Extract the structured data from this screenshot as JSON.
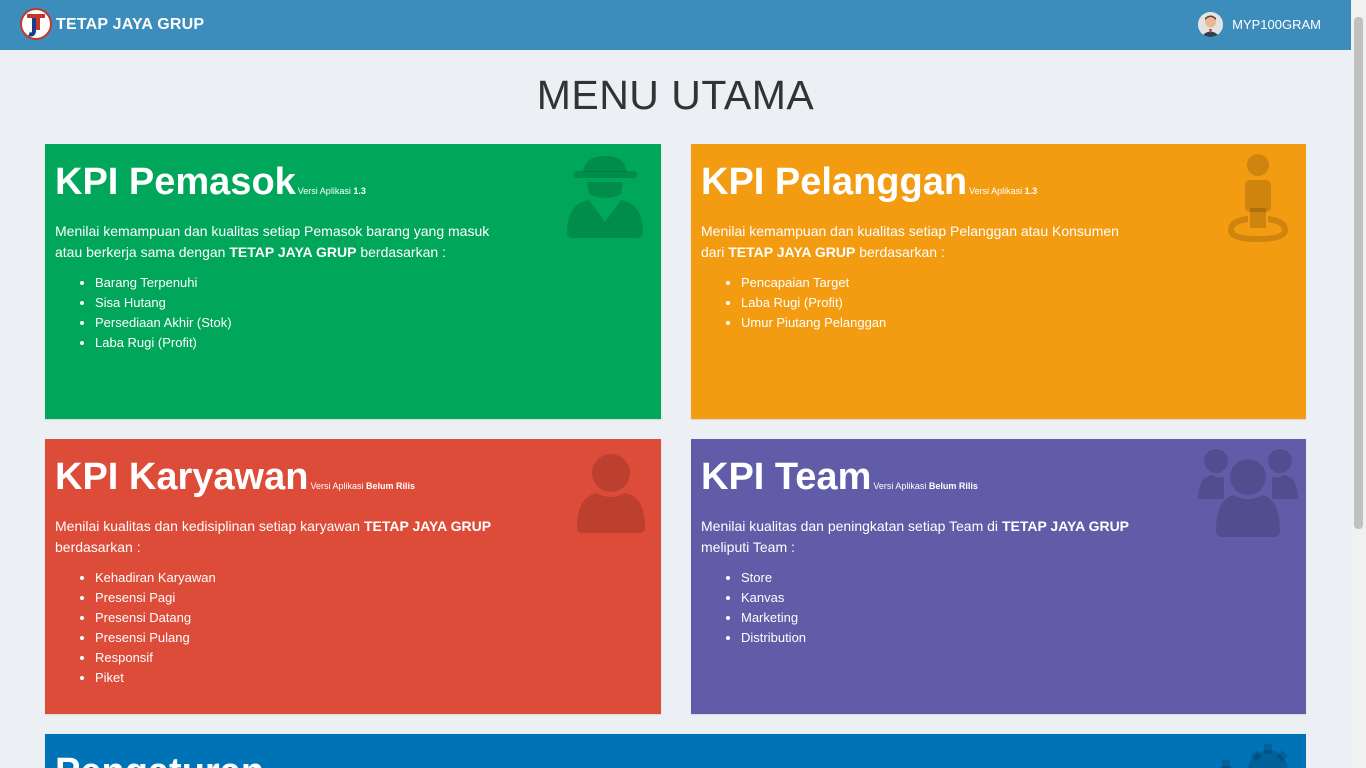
{
  "navbar": {
    "brand": "TETAP JAYA GRUP",
    "username": "MYP100GRAM"
  },
  "page": {
    "title": "MENU UTAMA"
  },
  "cards": {
    "pemasok": {
      "title": "KPI Pemasok",
      "version_label": "Versi Aplikasi",
      "version": "1.3",
      "desc_pre": "Menilai kemampuan dan kualitas setiap Pemasok barang yang masuk atau berkerja sama dengan",
      "desc_company": "TETAP JAYA GRUP",
      "desc_post": "berdasarkan :",
      "items": [
        "Barang Terpenuhi",
        "Sisa Hutang",
        "Persediaan Akhir (Stok)",
        "Laba Rugi (Profit)"
      ],
      "icon": "spy-icon",
      "color": "#00a65a"
    },
    "pelanggan": {
      "title": "KPI Pelanggan",
      "version_label": "Versi Aplikasi",
      "version": "1.3",
      "desc_pre": "Menilai kemampuan dan kualitas setiap Pelanggan atau Konsumen dari",
      "desc_company": "TETAP JAYA GRUP",
      "desc_post": "berdasarkan :",
      "items": [
        "Pencapaian Target",
        "Laba Rugi (Profit)",
        "Umur Piutang Pelanggan"
      ],
      "icon": "street-view-icon",
      "color": "#f39c12"
    },
    "karyawan": {
      "title": "KPI Karyawan",
      "version_label": "Versi Aplikasi",
      "version": "Belum Rilis",
      "desc_pre": "Menilai kualitas dan kedisiplinan setiap karyawan",
      "desc_company": "TETAP JAYA GRUP",
      "desc_post": "berdasarkan :",
      "items": [
        "Kehadiran Karyawan",
        "Presensi Pagi",
        "Presensi Datang",
        "Presensi Pulang",
        "Responsif",
        "Piket"
      ],
      "icon": "user-icon",
      "color": "#dd4b39"
    },
    "team": {
      "title": "KPI Team",
      "version_label": "Versi Aplikasi",
      "version": "Belum Rilis",
      "desc_pre": "Menilai kualitas dan peningkatan setiap Team di",
      "desc_company": "TETAP JAYA GRUP",
      "desc_post": "meliputi Team :",
      "items": [
        "Store",
        "Kanvas",
        "Marketing",
        "Distribution"
      ],
      "icon": "users-icon",
      "color": "#605ca8"
    },
    "pengaturan": {
      "title": "Pengaturan",
      "icon": "gears-icon",
      "color": "#0073b7"
    }
  }
}
